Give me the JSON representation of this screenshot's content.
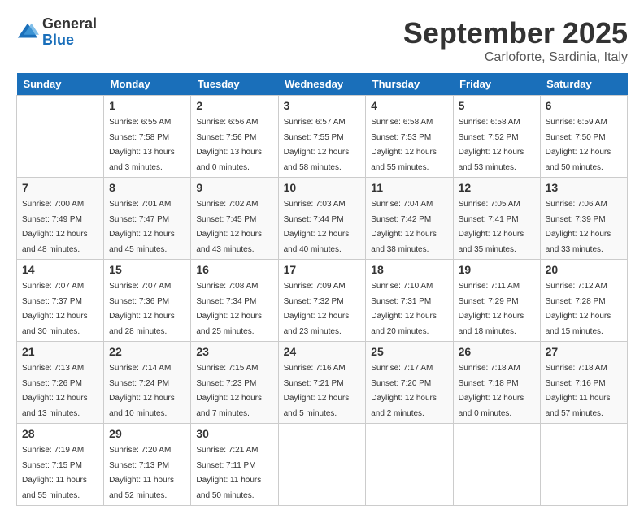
{
  "logo": {
    "general": "General",
    "blue": "Blue"
  },
  "title": "September 2025",
  "subtitle": "Carloforte, Sardinia, Italy",
  "days_of_week": [
    "Sunday",
    "Monday",
    "Tuesday",
    "Wednesday",
    "Thursday",
    "Friday",
    "Saturday"
  ],
  "weeks": [
    [
      {
        "day": "",
        "sunrise": "",
        "sunset": "",
        "daylight": ""
      },
      {
        "day": "1",
        "sunrise": "Sunrise: 6:55 AM",
        "sunset": "Sunset: 7:58 PM",
        "daylight": "Daylight: 13 hours and 3 minutes."
      },
      {
        "day": "2",
        "sunrise": "Sunrise: 6:56 AM",
        "sunset": "Sunset: 7:56 PM",
        "daylight": "Daylight: 13 hours and 0 minutes."
      },
      {
        "day": "3",
        "sunrise": "Sunrise: 6:57 AM",
        "sunset": "Sunset: 7:55 PM",
        "daylight": "Daylight: 12 hours and 58 minutes."
      },
      {
        "day": "4",
        "sunrise": "Sunrise: 6:58 AM",
        "sunset": "Sunset: 7:53 PM",
        "daylight": "Daylight: 12 hours and 55 minutes."
      },
      {
        "day": "5",
        "sunrise": "Sunrise: 6:58 AM",
        "sunset": "Sunset: 7:52 PM",
        "daylight": "Daylight: 12 hours and 53 minutes."
      },
      {
        "day": "6",
        "sunrise": "Sunrise: 6:59 AM",
        "sunset": "Sunset: 7:50 PM",
        "daylight": "Daylight: 12 hours and 50 minutes."
      }
    ],
    [
      {
        "day": "7",
        "sunrise": "Sunrise: 7:00 AM",
        "sunset": "Sunset: 7:49 PM",
        "daylight": "Daylight: 12 hours and 48 minutes."
      },
      {
        "day": "8",
        "sunrise": "Sunrise: 7:01 AM",
        "sunset": "Sunset: 7:47 PM",
        "daylight": "Daylight: 12 hours and 45 minutes."
      },
      {
        "day": "9",
        "sunrise": "Sunrise: 7:02 AM",
        "sunset": "Sunset: 7:45 PM",
        "daylight": "Daylight: 12 hours and 43 minutes."
      },
      {
        "day": "10",
        "sunrise": "Sunrise: 7:03 AM",
        "sunset": "Sunset: 7:44 PM",
        "daylight": "Daylight: 12 hours and 40 minutes."
      },
      {
        "day": "11",
        "sunrise": "Sunrise: 7:04 AM",
        "sunset": "Sunset: 7:42 PM",
        "daylight": "Daylight: 12 hours and 38 minutes."
      },
      {
        "day": "12",
        "sunrise": "Sunrise: 7:05 AM",
        "sunset": "Sunset: 7:41 PM",
        "daylight": "Daylight: 12 hours and 35 minutes."
      },
      {
        "day": "13",
        "sunrise": "Sunrise: 7:06 AM",
        "sunset": "Sunset: 7:39 PM",
        "daylight": "Daylight: 12 hours and 33 minutes."
      }
    ],
    [
      {
        "day": "14",
        "sunrise": "Sunrise: 7:07 AM",
        "sunset": "Sunset: 7:37 PM",
        "daylight": "Daylight: 12 hours and 30 minutes."
      },
      {
        "day": "15",
        "sunrise": "Sunrise: 7:07 AM",
        "sunset": "Sunset: 7:36 PM",
        "daylight": "Daylight: 12 hours and 28 minutes."
      },
      {
        "day": "16",
        "sunrise": "Sunrise: 7:08 AM",
        "sunset": "Sunset: 7:34 PM",
        "daylight": "Daylight: 12 hours and 25 minutes."
      },
      {
        "day": "17",
        "sunrise": "Sunrise: 7:09 AM",
        "sunset": "Sunset: 7:32 PM",
        "daylight": "Daylight: 12 hours and 23 minutes."
      },
      {
        "day": "18",
        "sunrise": "Sunrise: 7:10 AM",
        "sunset": "Sunset: 7:31 PM",
        "daylight": "Daylight: 12 hours and 20 minutes."
      },
      {
        "day": "19",
        "sunrise": "Sunrise: 7:11 AM",
        "sunset": "Sunset: 7:29 PM",
        "daylight": "Daylight: 12 hours and 18 minutes."
      },
      {
        "day": "20",
        "sunrise": "Sunrise: 7:12 AM",
        "sunset": "Sunset: 7:28 PM",
        "daylight": "Daylight: 12 hours and 15 minutes."
      }
    ],
    [
      {
        "day": "21",
        "sunrise": "Sunrise: 7:13 AM",
        "sunset": "Sunset: 7:26 PM",
        "daylight": "Daylight: 12 hours and 13 minutes."
      },
      {
        "day": "22",
        "sunrise": "Sunrise: 7:14 AM",
        "sunset": "Sunset: 7:24 PM",
        "daylight": "Daylight: 12 hours and 10 minutes."
      },
      {
        "day": "23",
        "sunrise": "Sunrise: 7:15 AM",
        "sunset": "Sunset: 7:23 PM",
        "daylight": "Daylight: 12 hours and 7 minutes."
      },
      {
        "day": "24",
        "sunrise": "Sunrise: 7:16 AM",
        "sunset": "Sunset: 7:21 PM",
        "daylight": "Daylight: 12 hours and 5 minutes."
      },
      {
        "day": "25",
        "sunrise": "Sunrise: 7:17 AM",
        "sunset": "Sunset: 7:20 PM",
        "daylight": "Daylight: 12 hours and 2 minutes."
      },
      {
        "day": "26",
        "sunrise": "Sunrise: 7:18 AM",
        "sunset": "Sunset: 7:18 PM",
        "daylight": "Daylight: 12 hours and 0 minutes."
      },
      {
        "day": "27",
        "sunrise": "Sunrise: 7:18 AM",
        "sunset": "Sunset: 7:16 PM",
        "daylight": "Daylight: 11 hours and 57 minutes."
      }
    ],
    [
      {
        "day": "28",
        "sunrise": "Sunrise: 7:19 AM",
        "sunset": "Sunset: 7:15 PM",
        "daylight": "Daylight: 11 hours and 55 minutes."
      },
      {
        "day": "29",
        "sunrise": "Sunrise: 7:20 AM",
        "sunset": "Sunset: 7:13 PM",
        "daylight": "Daylight: 11 hours and 52 minutes."
      },
      {
        "day": "30",
        "sunrise": "Sunrise: 7:21 AM",
        "sunset": "Sunset: 7:11 PM",
        "daylight": "Daylight: 11 hours and 50 minutes."
      },
      {
        "day": "",
        "sunrise": "",
        "sunset": "",
        "daylight": ""
      },
      {
        "day": "",
        "sunrise": "",
        "sunset": "",
        "daylight": ""
      },
      {
        "day": "",
        "sunrise": "",
        "sunset": "",
        "daylight": ""
      },
      {
        "day": "",
        "sunrise": "",
        "sunset": "",
        "daylight": ""
      }
    ]
  ]
}
